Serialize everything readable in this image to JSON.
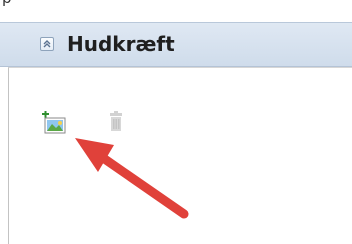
{
  "top_strip": {
    "text": "p"
  },
  "header": {
    "title": "Hudkræft",
    "collapse_icon": "chevron-double-up-icon"
  },
  "toolbar": {
    "add_image_icon": "add-image-icon",
    "delete_icon": "trash-icon"
  },
  "annotation": {
    "icon": "red-arrow-icon",
    "color": "#e0413a"
  },
  "colors": {
    "header_bg": "#d4e0ee",
    "panel_border": "#c3c3c3",
    "arrow": "#e0413a"
  }
}
